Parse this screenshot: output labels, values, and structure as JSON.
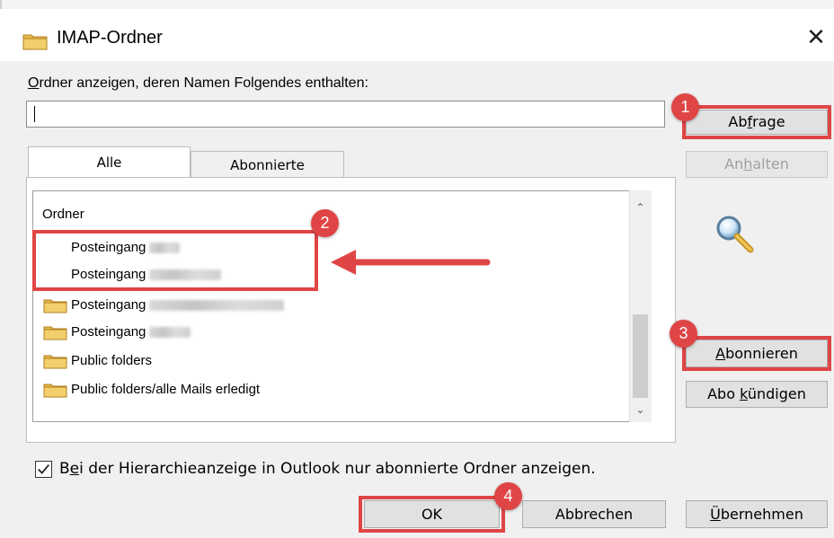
{
  "window": {
    "title": "IMAP-Ordner",
    "close_glyph": "✕",
    "folder_icon": "folder-icon"
  },
  "filter": {
    "label_first": "O",
    "label_rest": "rdner anzeigen, deren Namen Folgendes enthalten:",
    "value": ""
  },
  "buttons": {
    "abfrage_a": "Ab",
    "abfrage_u": "f",
    "abfrage_b": "rage",
    "anhalten_a": "An",
    "anhalten_u": "h",
    "anhalten_b": "alten",
    "abonnieren_u": "A",
    "abonnieren_b": "bonnieren",
    "abo_kuendigen_a": "Abo ",
    "abo_kuendigen_u": "k",
    "abo_kuendigen_b": "ündigen",
    "ok": "OK",
    "abbrechen": "Abbrechen",
    "uebernehmen_u": "Ü",
    "uebernehmen_b": "bernehmen"
  },
  "tabs": [
    {
      "label": "Alle",
      "active": true
    },
    {
      "label": "Abonnierte",
      "active": false
    }
  ],
  "list": {
    "header": "Ordner",
    "items": [
      {
        "label": "Posteingang",
        "icon": false
      },
      {
        "label": "Posteingang",
        "icon": false
      },
      {
        "label": "Posteingang",
        "icon": true
      },
      {
        "label": "Posteingang",
        "icon": true
      },
      {
        "label": "Public folders",
        "icon": true
      },
      {
        "label": "Public folders/alle Mails erledigt",
        "icon": true
      }
    ]
  },
  "checkbox": {
    "checked": true,
    "label_a": "B",
    "label_u": "e",
    "label_b": "i der Hierarchieanzeige in Outlook nur abonnierte Ordner anzeigen."
  },
  "annotations": {
    "badges": [
      "1",
      "2",
      "3",
      "4"
    ],
    "color": "#e04545"
  },
  "colors": {
    "dialog_bg": "#f0f0f0",
    "folder_yellow": "#e8b84a",
    "accent_red": "#e04545"
  }
}
